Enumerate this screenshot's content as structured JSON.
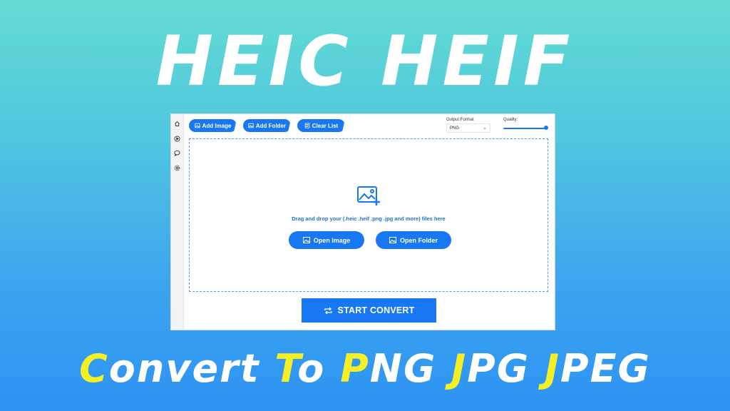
{
  "hero": {
    "title": "HEIC HEIF"
  },
  "toolbar": {
    "add_image": "Add Image",
    "add_folder": "Add Folder",
    "clear_list": "Clear List",
    "output_format_label": "Output Format",
    "output_format_value": "PNG",
    "quality_label": "Quality:",
    "quality_value": 1.0
  },
  "sidebar": {
    "icons": [
      "home-icon",
      "play-circle-icon",
      "chat-icon",
      "settings-icon"
    ]
  },
  "dropzone": {
    "text": "Drag and drop your (.heic .heif .png .jpg and more) files here",
    "open_image": "Open Image",
    "open_folder": "Open Folder"
  },
  "start_convert": "START CONVERT",
  "tagline": {
    "words": [
      {
        "first": "C",
        "rest": "onvert"
      },
      {
        "first": "T",
        "rest": "o"
      },
      {
        "first": "P",
        "rest": "NG"
      },
      {
        "first": "J",
        "rest": "PG"
      },
      {
        "first": "J",
        "rest": "PEG"
      }
    ]
  },
  "colors": {
    "accent": "#1877f2",
    "highlight": "#f5f026"
  }
}
